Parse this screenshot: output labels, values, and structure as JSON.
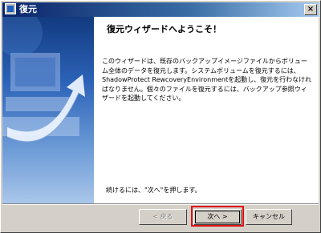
{
  "window": {
    "title": "復元",
    "close_glyph": "×"
  },
  "wizard": {
    "heading": "復元ウィザードへようこそ！",
    "body": "このウィザードは、既存のバックアップイメージファイルからボリューム全体のデータを復元します。システムボリュームを復元するには、ShadowProtect RewcoveryEnvironmentを起動し、復元を行わなければなりません。個々のファイルを復元するには、バックアップ参照ウィザードを起動してください。",
    "footer": "続けるには、\"次へ\"を押します。"
  },
  "buttons": {
    "back": "< 戻る",
    "next": "次へ >",
    "cancel": "キャンセル"
  },
  "colors": {
    "highlight": "#e01010",
    "titlebar": "#0a246a"
  }
}
